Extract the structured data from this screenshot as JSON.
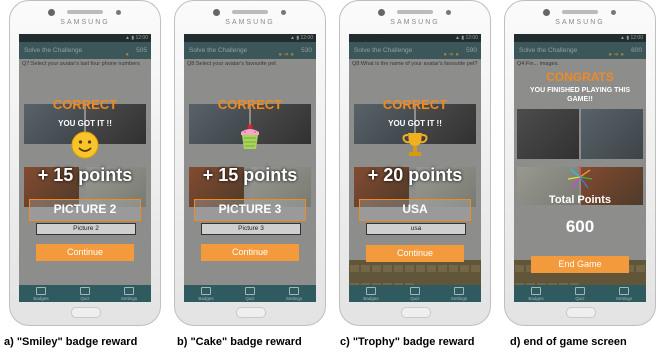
{
  "brand": "SAMSUNG",
  "status_time": "12:00",
  "app_title": "Solve the Challenge",
  "nav_labels": [
    "Badges",
    "Quiz",
    "Settings"
  ],
  "screens": [
    {
      "score": "505",
      "question": "Q7:Select your avatar's last four phone numbers",
      "result": "CORRECT",
      "message": "YOU GOT IT !!",
      "badge_icon": "smiley-icon",
      "points": "+ 15 points",
      "answer": "PICTURE 2",
      "input_value": "Picture 2",
      "button": "Continue",
      "caption": "a) \"Smiley\" badge reward"
    },
    {
      "score": "530",
      "question": "Q8:Select your avatar's favourite pet",
      "result": "CORRECT",
      "message": "",
      "badge_icon": "cake-icon",
      "points": "+ 15 points",
      "answer": "PICTURE 3",
      "input_value": "Picture 3",
      "button": "Continue",
      "caption": "b) \"Cake\" badge reward"
    },
    {
      "score": "590",
      "question": "Q8:What is the name of your avatar's favourite pet?",
      "result": "CORRECT",
      "message": "YOU GOT IT !!",
      "badge_icon": "trophy-icon",
      "points": "+ 20 points",
      "answer": "USA",
      "input_value": "usa",
      "button": "Continue",
      "caption": "c) \"Trophy\" badge reward"
    },
    {
      "score": "600",
      "question": "Q4:Fin... images.",
      "title": "CONGRATS",
      "message": "YOU FINISHED PLAYING THIS GAME!!",
      "total_label": "Total Points",
      "total_value": "600",
      "button": "End Game",
      "caption": "d) end of game screen"
    }
  ],
  "colors": {
    "accent": "#f08a22",
    "header": "#3d6b70",
    "button": "#f39a3c"
  }
}
